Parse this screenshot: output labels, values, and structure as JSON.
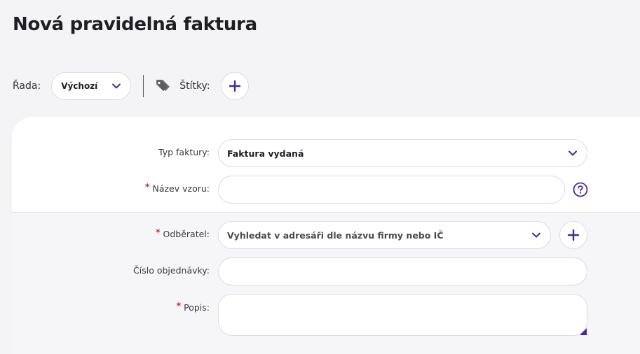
{
  "page": {
    "title": "Nová pravidelná faktura"
  },
  "toolbar": {
    "series_label": "Řada:",
    "series_value": "Výchozí",
    "tags_label": "Štítky:"
  },
  "form": {
    "invoice_type": {
      "label": "Typ faktury:",
      "value": "Faktura vydaná"
    },
    "template_name": {
      "label": "Název vzoru:",
      "required_mark": "*",
      "value": ""
    },
    "customer": {
      "label": "Odběratel:",
      "required_mark": "*",
      "placeholder": "Vyhledat v adresáři dle názvu firmy nebo IČ"
    },
    "order_number": {
      "label": "Číslo objednávky:",
      "value": ""
    },
    "description": {
      "label": "Popis:",
      "required_mark": "*",
      "value": ""
    }
  },
  "colors": {
    "accent": "#3b2f9e",
    "required": "#e0202b",
    "page_bg": "#f4f4f6"
  },
  "icons": [
    "chevron-down-icon",
    "tag-icon",
    "plus-icon",
    "question-icon"
  ]
}
